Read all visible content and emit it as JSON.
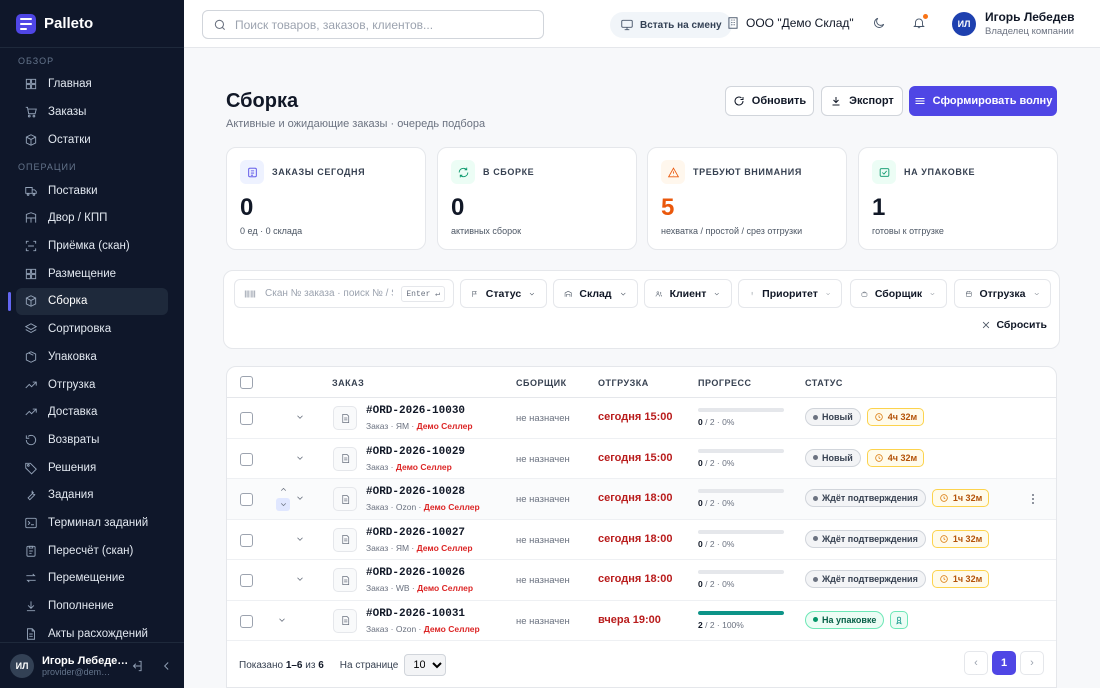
{
  "app": {
    "name": "Palleto"
  },
  "sidebar": {
    "sections": [
      {
        "title": "ОБЗОР",
        "items": [
          {
            "label": "Главная",
            "icon": "grid-icon"
          },
          {
            "label": "Заказы",
            "icon": "cart-icon"
          },
          {
            "label": "Остатки",
            "icon": "box-icon"
          }
        ]
      },
      {
        "title": "ОПЕРАЦИИ",
        "items": [
          {
            "label": "Поставки",
            "icon": "truck-icon"
          },
          {
            "label": "Двор / КПП",
            "icon": "gate-icon"
          },
          {
            "label": "Приёмка (скан)",
            "icon": "scan-icon"
          },
          {
            "label": "Размещение",
            "icon": "grid-icon"
          },
          {
            "label": "Сборка",
            "icon": "box-icon",
            "active": true
          },
          {
            "label": "Сортировка",
            "icon": "layers-icon"
          },
          {
            "label": "Упаковка",
            "icon": "package-icon"
          },
          {
            "label": "Отгрузка",
            "icon": "trend-icon"
          },
          {
            "label": "Доставка",
            "icon": "trend-icon"
          },
          {
            "label": "Возвраты",
            "icon": "return-icon"
          },
          {
            "label": "Решения",
            "icon": "tag-icon"
          },
          {
            "label": "Задания",
            "icon": "wrench-icon"
          },
          {
            "label": "Терминал заданий",
            "icon": "terminal-icon"
          },
          {
            "label": "Пересчёт (скан)",
            "icon": "clipboard-icon"
          },
          {
            "label": "Перемещение",
            "icon": "swap-icon"
          },
          {
            "label": "Пополнение",
            "icon": "refill-icon"
          },
          {
            "label": "Акты расхождений",
            "icon": "doc-icon"
          }
        ]
      }
    ],
    "user": {
      "initials": "ИЛ",
      "name": "Игорь Лебеде…",
      "email": "provider@dem…"
    }
  },
  "topbar": {
    "search_placeholder": "Поиск товаров, заказов, клиентов...",
    "shift_label": "Встать на смену",
    "org": "ООО \"Демо Склад\"",
    "user": {
      "initials": "ИЛ",
      "name": "Игорь Лебедев",
      "role": "Владелец компании"
    }
  },
  "page": {
    "title": "Сборка",
    "subtitle": "Активные и ожидающие заказы · очередь подбора",
    "buttons": {
      "refresh": "Обновить",
      "export": "Экспорт",
      "wave": "Сформировать волну"
    }
  },
  "kpis": [
    {
      "label": "ЗАКАЗЫ СЕГОДНЯ",
      "value": "0",
      "note": "0 ед · 0 склада",
      "color": "#111827",
      "icon_bg": "#eef2ff",
      "icon_stroke": "#4f46e5"
    },
    {
      "label": "В СБОРКЕ",
      "value": "0",
      "note": "активных сборок",
      "color": "#111827",
      "icon_bg": "#ecfdf5",
      "icon_stroke": "#059669"
    },
    {
      "label": "ТРЕБУЮТ ВНИМАНИЯ",
      "value": "5",
      "note": "нехватка / простой / срез отгрузки",
      "color": "#ea580c",
      "icon_bg": "#fff7ed",
      "icon_stroke": "#ea580c"
    },
    {
      "label": "НА УПАКОВКЕ",
      "value": "1",
      "note": "готовы к отгрузке",
      "color": "#111827",
      "icon_bg": "#ecfdf5",
      "icon_stroke": "#059669"
    }
  ],
  "filters": {
    "scan_placeholder": "Скан № заказа · поиск № / SK",
    "scan_key": "Enter ↵",
    "items": [
      "Статус",
      "Склад",
      "Клиент",
      "Приоритет",
      "Сборщик",
      "Отгрузка"
    ],
    "reset": "Сбросить"
  },
  "table": {
    "headers": {
      "order": "ЗАКАЗ",
      "picker": "СБОРЩИК",
      "shipment": "ОТГРУЗКА",
      "progress": "ПРОГРЕСС",
      "status": "СТАТУС"
    },
    "rows": [
      {
        "number": "#ORD-2026-10030",
        "meta": "Заказ · ЯМ · ",
        "seller": "Демо Селлер",
        "picker": "не назначен",
        "ship": "сегодня 15:00",
        "progress_text": "0",
        "progress_total": " / 2 · 0%",
        "progress": 0,
        "status": "Новый",
        "timer": "4ч 32м"
      },
      {
        "number": "#ORD-2026-10029",
        "meta": "Заказ · ",
        "seller": "Демо Селлер",
        "picker": "не назначен",
        "ship": "сегодня 15:00",
        "progress_text": "0",
        "progress_total": " / 2 · 0%",
        "progress": 0,
        "status": "Новый",
        "timer": "4ч 32м"
      },
      {
        "number": "#ORD-2026-10028",
        "meta": "Заказ · Ozon · ",
        "seller": "Демо Селлер",
        "picker": "не назначен",
        "ship": "сегодня 18:00",
        "progress_text": "0",
        "progress_total": " / 2 · 0%",
        "progress": 0,
        "status": "Ждёт подтверждения",
        "timer": "1ч 32м"
      },
      {
        "number": "#ORD-2026-10027",
        "meta": "Заказ · ЯМ · ",
        "seller": "Демо Селлер",
        "picker": "не назначен",
        "ship": "сегодня 18:00",
        "progress_text": "0",
        "progress_total": " / 2 · 0%",
        "progress": 0,
        "status": "Ждёт подтверждения",
        "timer": "1ч 32м"
      },
      {
        "number": "#ORD-2026-10026",
        "meta": "Заказ · WB · ",
        "seller": "Демо Селлер",
        "picker": "не назначен",
        "ship": "сегодня 18:00",
        "progress_text": "0",
        "progress_total": " / 2 · 0%",
        "progress": 0,
        "status": "Ждёт подтверждения",
        "timer": "1ч 32м"
      },
      {
        "number": "#ORD-2026-10031",
        "meta": "Заказ · Ozon · ",
        "seller": "Демо Селлер",
        "picker": "не назначен",
        "ship": "вчера 19:00",
        "progress_text": "2",
        "progress_total": " / 2 · 100%",
        "progress": 1,
        "status": "На упаковке"
      }
    ],
    "footer": {
      "shown_prefix": "Показано ",
      "shown_range": "1–6",
      "shown_of": " из ",
      "shown_total": "6",
      "per_page_label": "На странице",
      "per_page": "10",
      "page": "1"
    }
  }
}
